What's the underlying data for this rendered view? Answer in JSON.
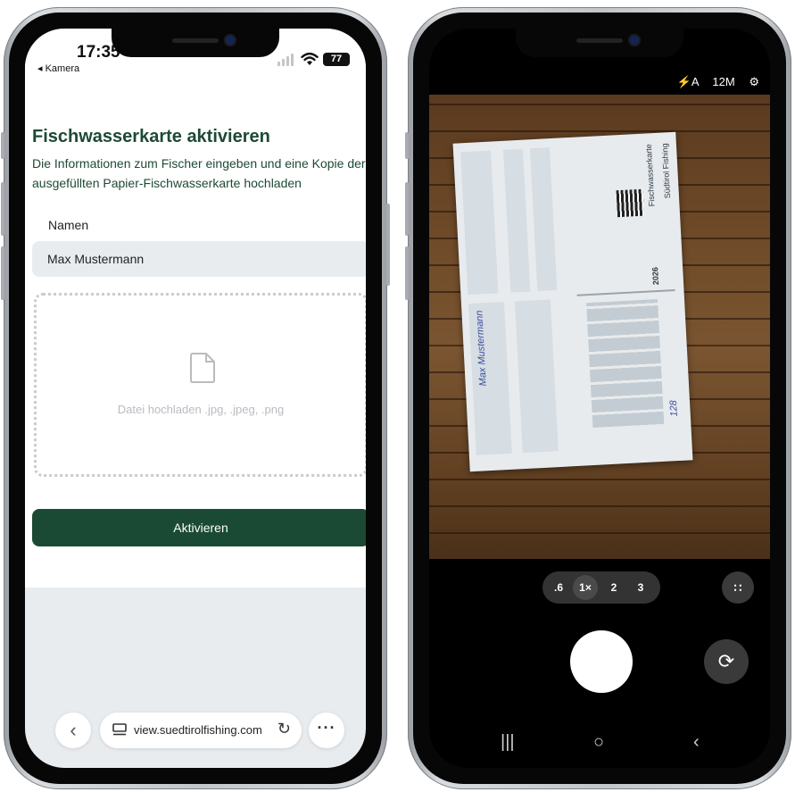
{
  "left_phone": {
    "status": {
      "time": "17:35",
      "back_app": "◂ Kamera",
      "battery": "77"
    },
    "page": {
      "title": "Fischwasserkarte aktivieren",
      "subtitle": "Die Informationen zum Fischer eingeben und eine Kopie der ausgefüllten Papier-Fischwasserkarte hochladen",
      "name_label": "Namen",
      "name_value": "Max Mustermann",
      "upload_hint": "Datei hochladen .jpg, .jpeg, .png",
      "submit_label": "Aktivieren"
    },
    "browser": {
      "url": "view.suedtirolfishing.com",
      "back_icon": "chevron-left-icon",
      "reload_icon": "reload-icon",
      "more_icon": "more-icon"
    }
  },
  "right_phone": {
    "camera": {
      "flash": "⚡A",
      "resolution": "12M",
      "zoom_levels": [
        ".6",
        "1×",
        "2",
        "3"
      ],
      "zoom_selected": "1×"
    },
    "document": {
      "brand": "Südtirol Fishing",
      "title": "Fischwasserkarte",
      "year": "2026",
      "handwritten_name": "Max Mustermann",
      "handwritten_value": "128"
    }
  },
  "colors": {
    "brand_green": "#1a4a33",
    "title_green": "#1d4a34",
    "input_bg": "#e9ecef",
    "dropzone_border": "#c9ccd0"
  }
}
